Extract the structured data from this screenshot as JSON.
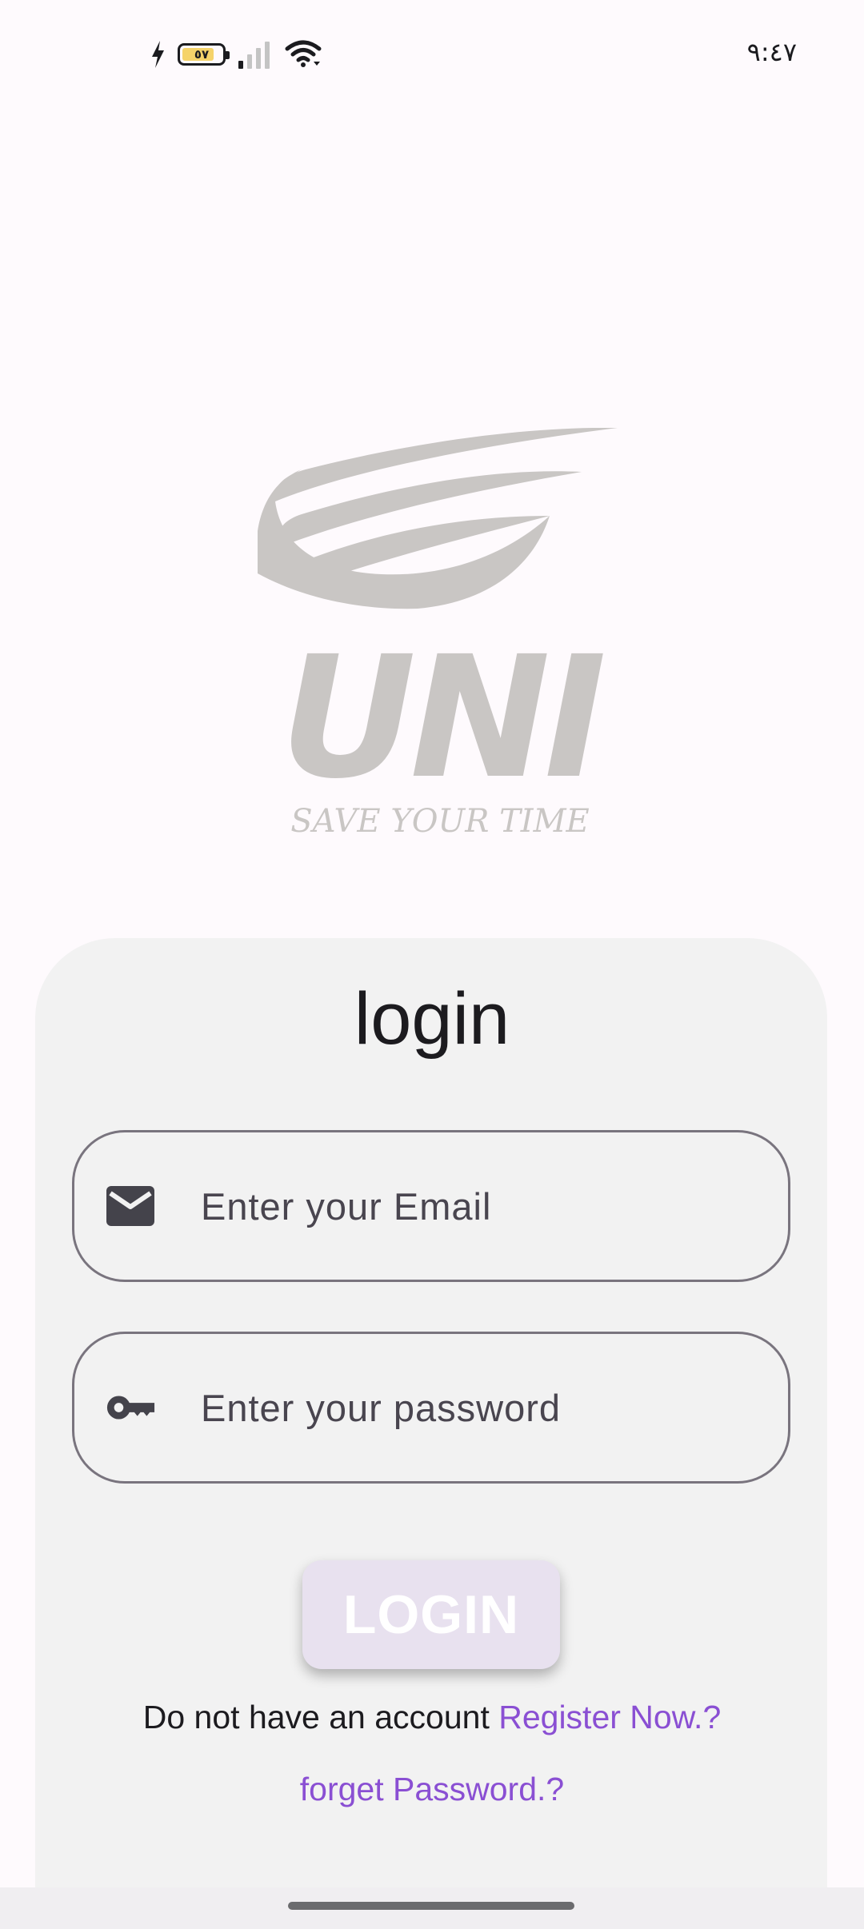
{
  "status_bar": {
    "time": "٩:٤٧",
    "battery_level": "٥٧",
    "battery_fill_color": "#f5d36a"
  },
  "logo": {
    "wordmark": "UNI",
    "tagline": "SAVE YOUR TIME",
    "color": "#c9c6c4"
  },
  "login_card": {
    "title": "login",
    "email_field": {
      "placeholder": "Enter your Email",
      "value": ""
    },
    "password_field": {
      "placeholder": "Enter your password",
      "value": ""
    },
    "login_button_label": "LOGIN",
    "register_prompt": "Do not have an account ",
    "register_link": "Register Now.?",
    "forget_password_link": "forget Password.?"
  },
  "colors": {
    "accent": "#8a4fd3",
    "card_background": "#f2f2f2",
    "page_background": "#fefafd",
    "button_background": "#e8e1ef"
  }
}
